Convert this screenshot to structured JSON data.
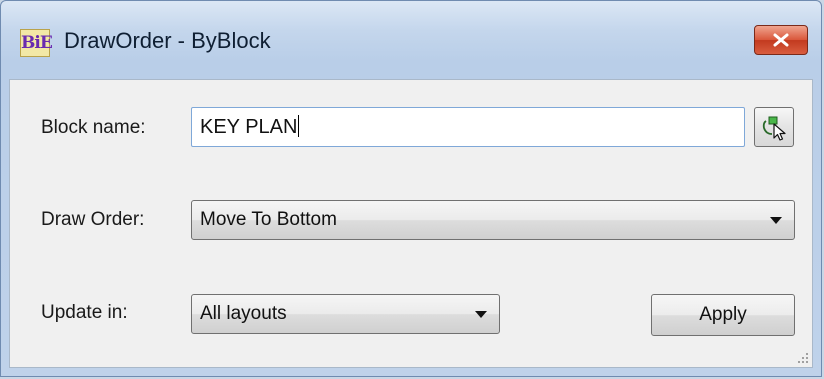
{
  "window": {
    "title": "DrawOrder - ByBlock",
    "app_icon_text": "BiE",
    "close_icon": "close-icon"
  },
  "form": {
    "block_name_label": "Block name:",
    "block_name_value": "KEY PLAN",
    "pick_button_icon": "select-object-icon",
    "draw_order_label": "Draw Order:",
    "draw_order_value": "Move To Bottom",
    "update_in_label": "Update in:",
    "update_in_value": "All layouts",
    "apply_label": "Apply"
  },
  "colors": {
    "close_button": "#c23a1f",
    "textbox_border": "#7fa8d8",
    "app_icon_text": "#6a2bb0"
  }
}
